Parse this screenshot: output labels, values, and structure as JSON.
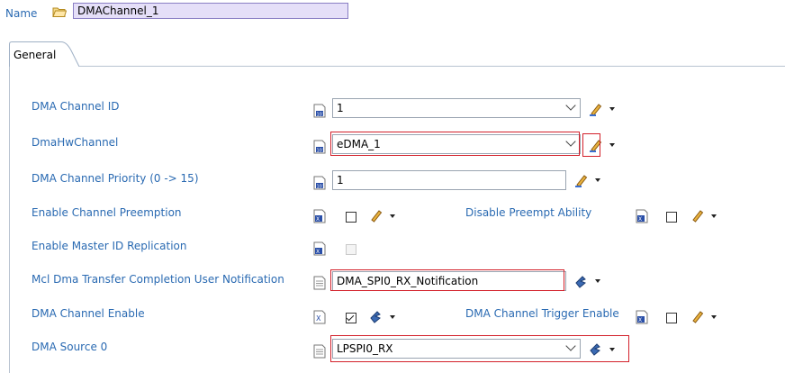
{
  "header": {
    "name_label": "Name",
    "name_value": "DMAChannel_1"
  },
  "tabs": [
    {
      "label": "General",
      "selected": true
    }
  ],
  "fields": {
    "dma_channel_id": {
      "label": "DMA Channel ID",
      "value": "1"
    },
    "dma_hw_channel": {
      "label": "DmaHwChannel",
      "value": "eDMA_1"
    },
    "dma_channel_priority": {
      "label": "DMA Channel Priority (0 -> 15)",
      "value": "1"
    },
    "enable_channel_preemption": {
      "label": "Enable Channel Preemption",
      "checked": false
    },
    "disable_preempt_ability": {
      "label": "Disable Preempt Ability",
      "checked": false
    },
    "enable_master_id_replication": {
      "label": "Enable Master ID Replication",
      "checked": false,
      "enabled": false
    },
    "mcl_dma_transfer_completion_user_notification": {
      "label": "Mcl Dma Transfer Completion User Notification",
      "value": "DMA_SPI0_RX_Notification"
    },
    "dma_channel_enable": {
      "label": "DMA Channel Enable",
      "checked": true
    },
    "dma_channel_trigger_enable": {
      "label": "DMA Channel Trigger Enable",
      "checked": false
    },
    "dma_source_0": {
      "label": "DMA Source 0",
      "value": "LPSPI0_RX"
    }
  },
  "colors": {
    "label_blue": "#2a6ab2",
    "highlight_red": "#d3212b",
    "name_field_bg": "#e5dff8"
  },
  "icons": [
    "folder-icon",
    "config-value-icon",
    "text-value-icon",
    "pencil-edit-icon",
    "link-ref-icon",
    "dropdown-arrow-icon",
    "chevron-down-icon"
  ]
}
